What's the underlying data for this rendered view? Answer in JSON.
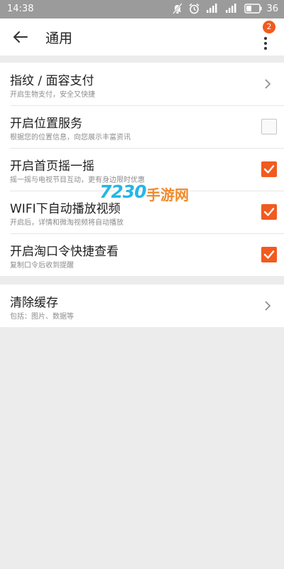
{
  "status_bar": {
    "time": "14:38",
    "battery_level": "36",
    "icons": [
      "notifications-off-icon",
      "alarm-icon",
      "signal-4g-icon",
      "signal-icon",
      "battery-icon"
    ]
  },
  "header": {
    "title": "通用",
    "back_icon": "arrow-left-icon",
    "more_icon": "more-vertical-icon",
    "badge_count": "2"
  },
  "sections": [
    {
      "items": [
        {
          "title": "指纹 / 面容支付",
          "subtitle": "开启生物支付，安全又快捷",
          "control": "chevron"
        },
        {
          "title": "开启位置服务",
          "subtitle": "根据您的位置信息，向您展示丰富资讯",
          "control": "checkbox",
          "checked": false
        },
        {
          "title": "开启首页摇一摇",
          "subtitle": "摇一摇与电视节目互动，更有身边限时优惠",
          "control": "checkbox",
          "checked": true
        },
        {
          "title": "WIFI下自动播放视频",
          "subtitle": "开启后，详情和微淘视频将自动播放",
          "control": "checkbox",
          "checked": true
        },
        {
          "title": "开启淘口令快捷查看",
          "subtitle": "复制口令后收到提醒",
          "control": "checkbox",
          "checked": true
        }
      ]
    },
    {
      "items": [
        {
          "title": "清除缓存",
          "subtitle": "包括：图片、数据等",
          "control": "chevron"
        }
      ]
    }
  ],
  "watermark": {
    "number": "7230",
    "text": "手游网"
  },
  "colors": {
    "accent": "#f25a1f",
    "status_bar": "#9b9b9b",
    "background": "#ececec",
    "watermark_blue": "#25b6e6",
    "watermark_orange": "#f08a2a"
  }
}
